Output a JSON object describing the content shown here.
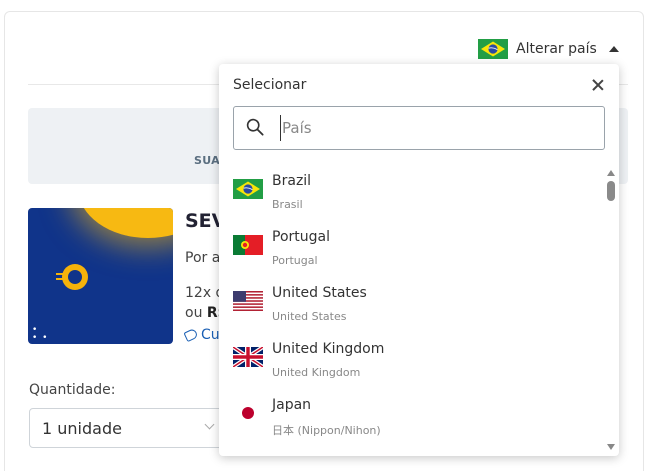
{
  "header": {
    "change_country_label": "Alterar país"
  },
  "banner": {
    "text": "SUA"
  },
  "product": {
    "title": "SEV",
    "line1": "Por a",
    "line2": "12x d",
    "line3_prefix": "ou ",
    "line3_bold": "R$",
    "line4": "Cu"
  },
  "quantity": {
    "label": "Quantidade:",
    "selected": "1 unidade"
  },
  "dropdown": {
    "title": "Selecionar",
    "search_placeholder": "País",
    "countries": [
      {
        "name": "Brazil",
        "native": "Brasil",
        "flag": "brazil-flag-icon"
      },
      {
        "name": "Portugal",
        "native": "Portugal",
        "flag": "portugal-flag-icon"
      },
      {
        "name": "United States",
        "native": "United States",
        "flag": "usa-flag-icon"
      },
      {
        "name": "United Kingdom",
        "native": "United Kingdom",
        "flag": "uk-flag-icon"
      },
      {
        "name": "Japan",
        "native": "日本 (Nippon/Nihon)",
        "flag": "japan-flag-icon"
      }
    ]
  },
  "colors": {
    "link": "#1a5fb4",
    "banner_bg": "#eef1f4",
    "product_bg": "#10348a",
    "accent_yellow": "#f5b20a"
  }
}
